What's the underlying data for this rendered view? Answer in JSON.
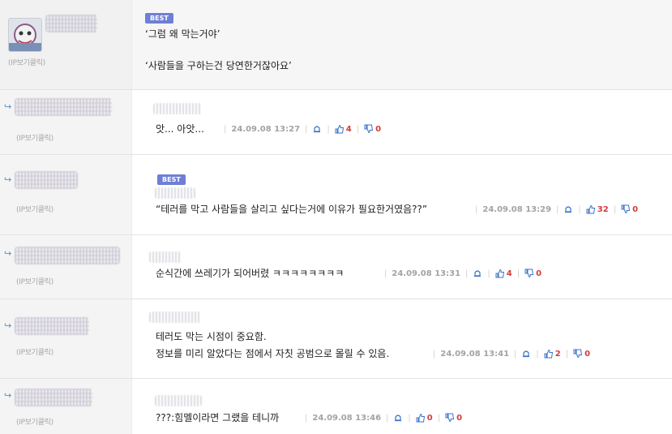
{
  "badge": "BEST",
  "ip_label": "(IP보기클릭)",
  "comments": [
    {
      "best": true,
      "line1": "‘그럼 왜 막는거야’",
      "line2": "‘사람들을 구하는건 당연한거잖아요’"
    },
    {
      "text": "앗... 아앗...",
      "date": "24.09.08 13:27",
      "up": "4",
      "down": "0"
    },
    {
      "best": true,
      "text": "“테러를 막고 사람들을 살리고 싶다는거에 이유가 필요한거였음??”",
      "date": "24.09.08 13:29",
      "up": "32",
      "down": "0"
    },
    {
      "text": "순식간에 쓰레기가 되어버렸 ㅋㅋㅋㅋㅋㅋㅋㅋ",
      "date": "24.09.08 13:31",
      "up": "4",
      "down": "0"
    },
    {
      "line1": "테러도 막는 시점이 중요함.",
      "text": "정보를 미리 알았다는 점에서 자칫 공범으로 몰릴 수 있음.",
      "date": "24.09.08 13:41",
      "up": "2",
      "down": "0"
    },
    {
      "text": "???:힘멜이라면 그랬을 테니까",
      "date": "24.09.08 13:46",
      "up": "0",
      "down": "0"
    }
  ],
  "icons": {
    "reply": "reply-arrow-icon",
    "report": "bell-icon",
    "like": "thumbs-up-icon",
    "dislike": "thumbs-down-icon"
  },
  "colors": {
    "badge": "#6f7fd6",
    "count": "#d43b3b",
    "icon": "#3b73c8"
  }
}
